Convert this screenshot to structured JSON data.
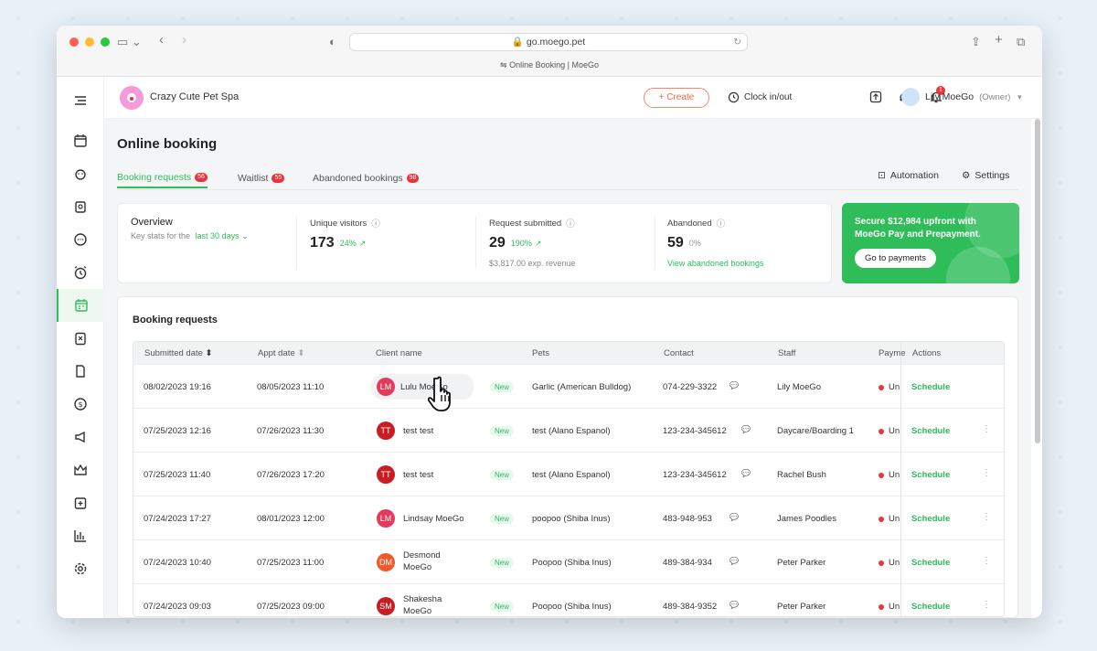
{
  "browser": {
    "url": "go.moego.pet",
    "tab_title": "Online Booking | MoeGo"
  },
  "topbar": {
    "business_name": "Crazy Cute Pet Spa",
    "create_label": "+ Create",
    "clock_label": "Clock in/out",
    "notification_count": "1",
    "user_name": "Lily MoeGo",
    "user_role": "(Owner)"
  },
  "page": {
    "title": "Online booking",
    "tabs": [
      {
        "label": "Booking requests",
        "count": "56"
      },
      {
        "label": "Waitlist",
        "count": "55"
      },
      {
        "label": "Abandoned bookings",
        "count": "98"
      }
    ],
    "automation_label": "Automation",
    "settings_label": "Settings"
  },
  "overview": {
    "title": "Overview",
    "subtitle": "Key stats for the",
    "range": "last 30 days",
    "unique_visitors": {
      "label": "Unique visitors",
      "value": "173",
      "pct": "24%"
    },
    "request_submitted": {
      "label": "Request submitted",
      "value": "29",
      "pct": "190%",
      "sub": "$3,817.00 exp. revenue"
    },
    "abandoned": {
      "label": "Abandoned",
      "value": "59",
      "pct": "0%",
      "link": "View abandoned bookings"
    }
  },
  "promo": {
    "text": "Secure $12,984 upfront with MoeGo Pay and Prepayment.",
    "button": "Go to payments"
  },
  "table": {
    "title": "Booking requests",
    "headers": [
      "Submitted date",
      "Appt date",
      "Client name",
      "Pets",
      "Contact",
      "Staff",
      "Payme",
      "Actions"
    ],
    "rows": [
      {
        "submitted": "08/02/2023 19:16",
        "appt": "08/05/2023 11:10",
        "initials": "LM",
        "client": "Lulu MoeGo",
        "client2": "",
        "avatar_color": "#e23b5c",
        "pets": "Garlic (American Bulldog)",
        "contact": "074-229-3322",
        "staff": "Lily MoeGo",
        "payment": "Un",
        "action": "Schedule"
      },
      {
        "submitted": "07/25/2023 12:16",
        "appt": "07/26/2023 11:30",
        "initials": "TT",
        "client": "test test",
        "client2": "",
        "avatar_color": "#c81d25",
        "pets": "test (Alano Espanol)",
        "contact": "123-234-345612",
        "staff": "Daycare/Boarding 1",
        "payment": "Un",
        "action": "Schedule"
      },
      {
        "submitted": "07/25/2023 11:40",
        "appt": "07/26/2023 17:20",
        "initials": "TT",
        "client": "test test",
        "client2": "",
        "avatar_color": "#c81d25",
        "pets": "test (Alano Espanol)",
        "contact": "123-234-345612",
        "staff": "Rachel Bush",
        "payment": "Un",
        "action": "Schedule"
      },
      {
        "submitted": "07/24/2023 17:27",
        "appt": "08/01/2023 12:00",
        "initials": "LM",
        "client": "Lindsay MoeGo",
        "client2": "",
        "avatar_color": "#e23b5c",
        "pets": "poopoo (Shiba Inus)",
        "contact": "483-948-953",
        "staff": "James Poodles",
        "payment": "Un",
        "action": "Schedule"
      },
      {
        "submitted": "07/24/2023 10:40",
        "appt": "07/25/2023 11:00",
        "initials": "DM",
        "client": "Desmond",
        "client2": "MoeGo",
        "avatar_color": "#f05a28",
        "pets": "Poopoo (Shiba Inus)",
        "contact": "489-384-934",
        "staff": "Peter Parker",
        "payment": "Un",
        "action": "Schedule"
      },
      {
        "submitted": "07/24/2023 09:03",
        "appt": "07/25/2023 09:00",
        "initials": "SM",
        "client": "Shakesha",
        "client2": "MoeGo",
        "avatar_color": "#c81d25",
        "pets": "Poopoo (Shiba Inus)",
        "contact": "489-384-9352",
        "staff": "Peter Parker",
        "payment": "Un",
        "action": "Schedule"
      }
    ],
    "new_label": "New"
  },
  "colors": {
    "accent": "#2ebd59",
    "danger": "#e8323c",
    "create": "#f06b45"
  }
}
